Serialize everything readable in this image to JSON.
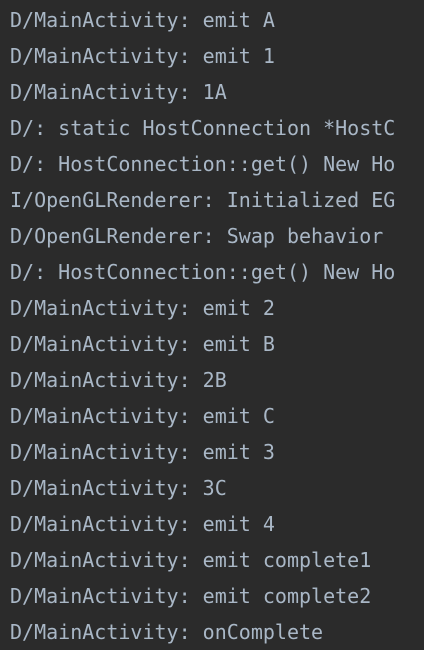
{
  "console": {
    "lines": [
      {
        "text": "D/MainActivity: emit A"
      },
      {
        "text": "D/MainActivity: emit 1"
      },
      {
        "text": "D/MainActivity: 1A"
      },
      {
        "text": "D/: static HostConnection *HostC"
      },
      {
        "text": "D/: HostConnection::get() New Ho"
      },
      {
        "text": "I/OpenGLRenderer: Initialized EG"
      },
      {
        "text": "D/OpenGLRenderer: Swap behavior "
      },
      {
        "text": "D/: HostConnection::get() New Ho"
      },
      {
        "text": "D/MainActivity: emit 2"
      },
      {
        "text": "D/MainActivity: emit B"
      },
      {
        "text": "D/MainActivity: 2B"
      },
      {
        "text": "D/MainActivity: emit C"
      },
      {
        "text": "D/MainActivity: emit 3"
      },
      {
        "text": "D/MainActivity: 3C"
      },
      {
        "text": "D/MainActivity: emit 4"
      },
      {
        "text": "D/MainActivity: emit complete1"
      },
      {
        "text": "D/MainActivity: emit complete2"
      },
      {
        "text": "D/MainActivity: onComplete"
      }
    ]
  },
  "colors": {
    "background": "#2b2b2b",
    "text": "#a9b7c6"
  }
}
